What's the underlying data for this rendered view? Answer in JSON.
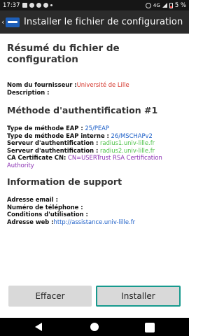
{
  "status_bar": {
    "time": "17:37",
    "left_icons": [
      "sync-icon",
      "messenger-icon",
      "messenger-icon",
      "messenger-icon"
    ],
    "network": "4G",
    "battery": "5 %"
  },
  "app_bar": {
    "title": "Installer le fichier de configuration",
    "icon": "app-icon"
  },
  "summary": {
    "heading": "Résumé du fichier de configuration",
    "provider_label": "Nom du fournisseur :",
    "provider_value": "Université de Lille",
    "description_label": "Description :",
    "description_value": ""
  },
  "auth": {
    "heading": "Méthode d'authentification #1",
    "eap_type_label": "Type de méthode EAP :",
    "eap_type_value": " 25/PEAP",
    "eap_inner_label": "Type de méthode EAP interne :",
    "eap_inner_value": " 26/MSCHAPv2",
    "server1_label": "Serveur d'authentification :",
    "server1_value": " radius1.univ-lille.fr",
    "server2_label": "Serveur d'authentification :",
    "server2_value": " radius2.univ-lille.fr",
    "ca_label": "CA Certificate CN:",
    "ca_value": " CN=USERTrust RSA Certification Authority"
  },
  "support": {
    "heading": "Information de support",
    "email_label": "Adresse email :",
    "phone_label": "Numéro de téléphone :",
    "terms_label": "Conditions d'utilisation :",
    "web_label": "Adresse web :",
    "web_value": "http://assistance.univ-lille.fr"
  },
  "buttons": {
    "clear_label": "Effacer",
    "install_label": "Installer"
  },
  "colors": {
    "provider": "#d4342a",
    "method": "#1b5ec7",
    "server": "#4fc24a",
    "certificate": "#8a2fb2",
    "focus": "#179a8e"
  }
}
